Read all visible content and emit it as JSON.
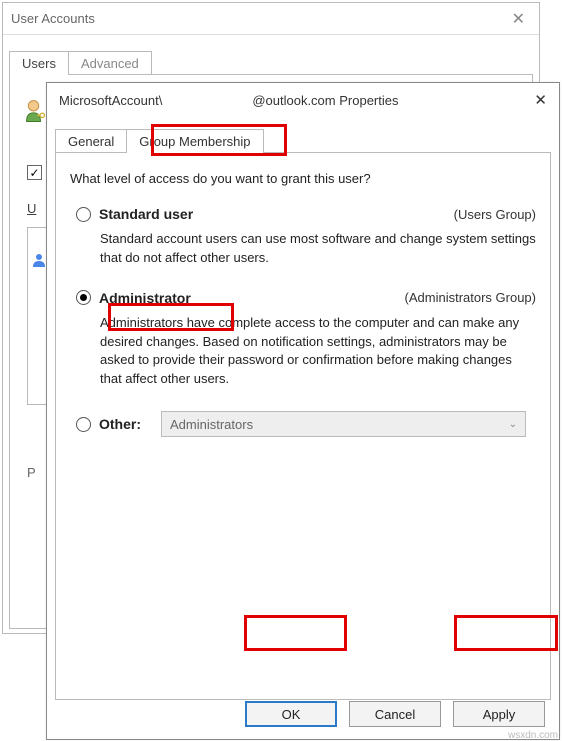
{
  "back_window": {
    "title": "User Accounts",
    "tabs": {
      "users": "Users",
      "advanced": "Advanced"
    },
    "checkbox_checked": "✓",
    "u_label": "U",
    "p_label": "P"
  },
  "front_window": {
    "title_part1": "MicrosoftAccount\\",
    "title_part2": "@outlook.com Properties",
    "tabs": {
      "general": "General",
      "group_membership": "Group Membership"
    },
    "question": "What level of access do you want to grant this user?",
    "options": {
      "standard": {
        "label": "Standard user",
        "group": "(Users Group)",
        "desc": "Standard account users can use most software and change system settings that do not affect other users."
      },
      "admin": {
        "label": "Administrator",
        "group": "(Administrators Group)",
        "desc": "Administrators have complete access to the computer and can make any desired changes. Based on notification settings, administrators may be asked to provide their password or confirmation before making changes that affect other users."
      },
      "other": {
        "label": "Other:",
        "select_value": "Administrators"
      }
    },
    "selected": "admin",
    "buttons": {
      "ok": "OK",
      "cancel": "Cancel",
      "apply": "Apply"
    }
  },
  "attribution": "wsxdn.com"
}
